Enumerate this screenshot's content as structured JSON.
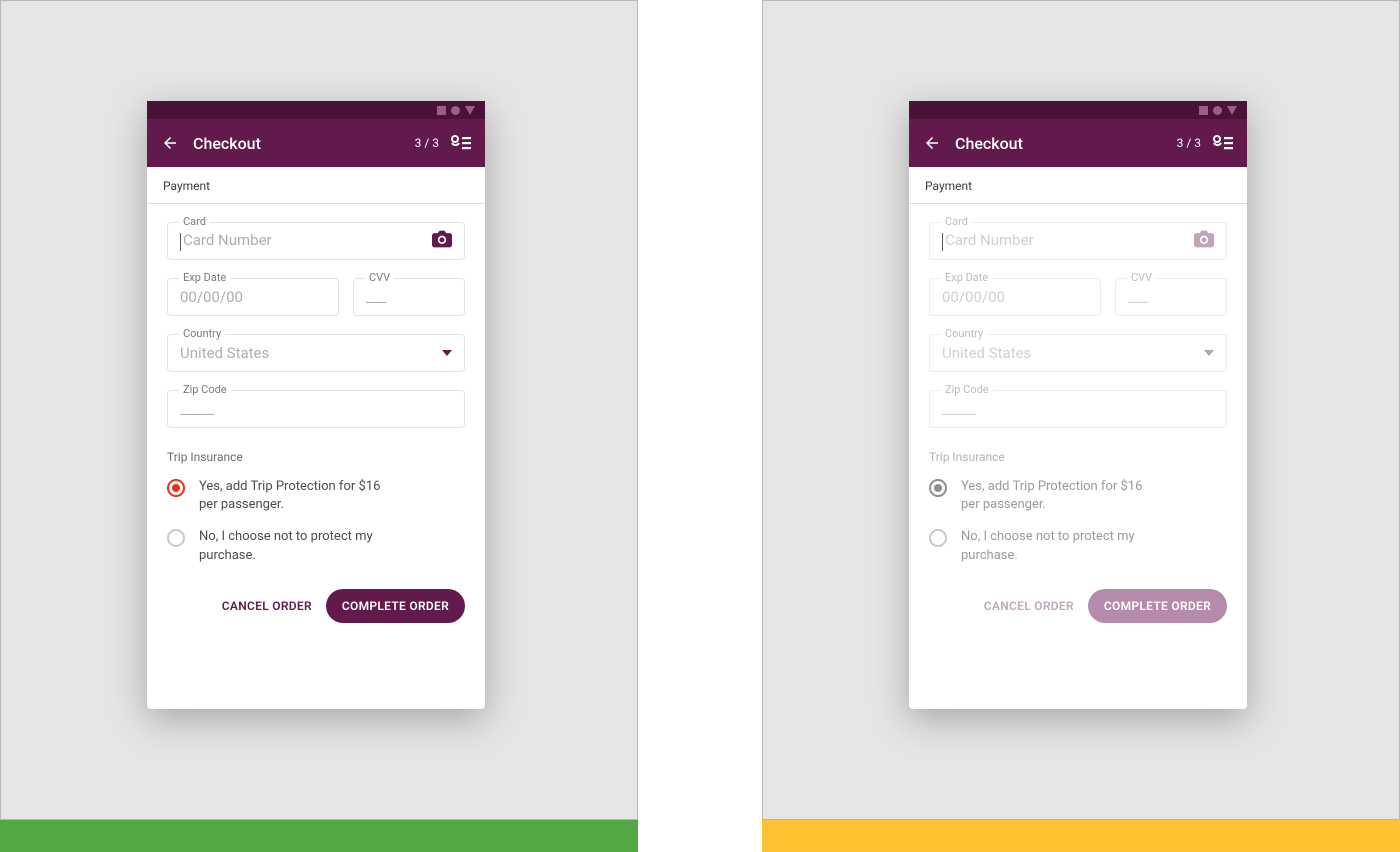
{
  "header": {
    "title": "Checkout",
    "step": "3 / 3"
  },
  "section": {
    "payment_label": "Payment"
  },
  "fields": {
    "card_label": "Card",
    "card_placeholder": "Card Number",
    "exp_label": "Exp Date",
    "exp_placeholder": "00/00/00",
    "cvv_label": "CVV",
    "cvv_placeholder": "___",
    "country_label": "Country",
    "country_value": "United States",
    "zip_label": "Zip Code",
    "zip_placeholder": "_____"
  },
  "insurance": {
    "section_label": "Trip Insurance",
    "yes_text": "Yes, add Trip Protection for $16 per passenger.",
    "no_text": "No, I choose not to protect my purchase."
  },
  "actions": {
    "cancel": "CANCEL ORDER",
    "complete": "COMPLETE ORDER"
  }
}
